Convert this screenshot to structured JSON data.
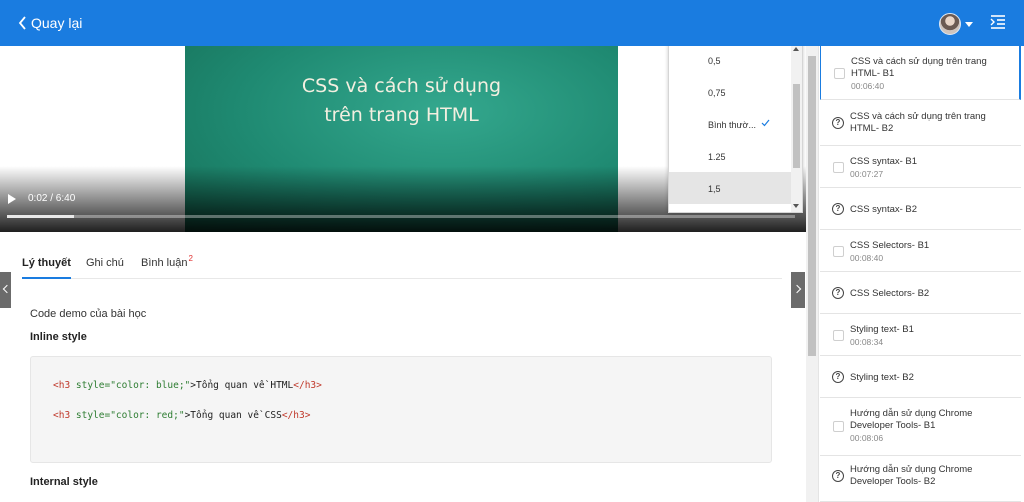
{
  "header": {
    "back_label": "Quay lại",
    "bg": "#1a7ce0",
    "avatar_icon": "user-avatar",
    "menu_icon": "menu-indent-icon"
  },
  "video": {
    "slide_title": "CSS và cách sử dụng\ntrên trang HTML",
    "time": "0:02 / 6:40",
    "progress": 0.085
  },
  "speed_menu": {
    "options": [
      "0,5",
      "0,75",
      "Bình thườ...",
      "1.25",
      "1,5"
    ],
    "checked": "Bình thườ...",
    "hovered": "1,5"
  },
  "tabs": {
    "theory": "Lý thuyết",
    "notes": "Ghi chú",
    "comments": "Bình luận",
    "comments_badge": "2"
  },
  "content": {
    "demo_caption": "Code demo của bài học",
    "inline_heading": "Inline style",
    "code": [
      {
        "open": "<h3",
        "attr": " style=\"color: blue;\"",
        "close": ">",
        "text": "Tổng quan về HTML",
        "end": "</h3>"
      },
      {
        "open": "<h3",
        "attr": " style=\"color: red;\"",
        "close": ">",
        "text": "Tổng quan về CSS",
        "end": "</h3>"
      }
    ],
    "internal_heading": "Internal style"
  },
  "sidebar": {
    "lessons": [
      {
        "title": "CSS và cách sử dụng trên trang HTML- B1",
        "duration": "00:06:40",
        "kind": "video",
        "active": true
      },
      {
        "title": "CSS và cách sử dụng trên trang HTML- B2",
        "duration": "",
        "kind": "quiz"
      },
      {
        "title": "CSS syntax- B1",
        "duration": "00:07:27",
        "kind": "video"
      },
      {
        "title": "CSS syntax- B2",
        "duration": "",
        "kind": "quiz"
      },
      {
        "title": "CSS Selectors- B1",
        "duration": "00:08:40",
        "kind": "video"
      },
      {
        "title": "CSS Selectors- B2",
        "duration": "",
        "kind": "quiz"
      },
      {
        "title": "Styling text- B1",
        "duration": "00:08:34",
        "kind": "video"
      },
      {
        "title": "Styling text- B2",
        "duration": "",
        "kind": "quiz"
      },
      {
        "title": "Hướng dẫn sử dụng Chrome Developer Tools- B1",
        "duration": "00:08:06",
        "kind": "video"
      },
      {
        "title": "Hướng dẫn sử dụng Chrome Developer Tools- B2",
        "duration": "",
        "kind": "quiz"
      }
    ]
  }
}
